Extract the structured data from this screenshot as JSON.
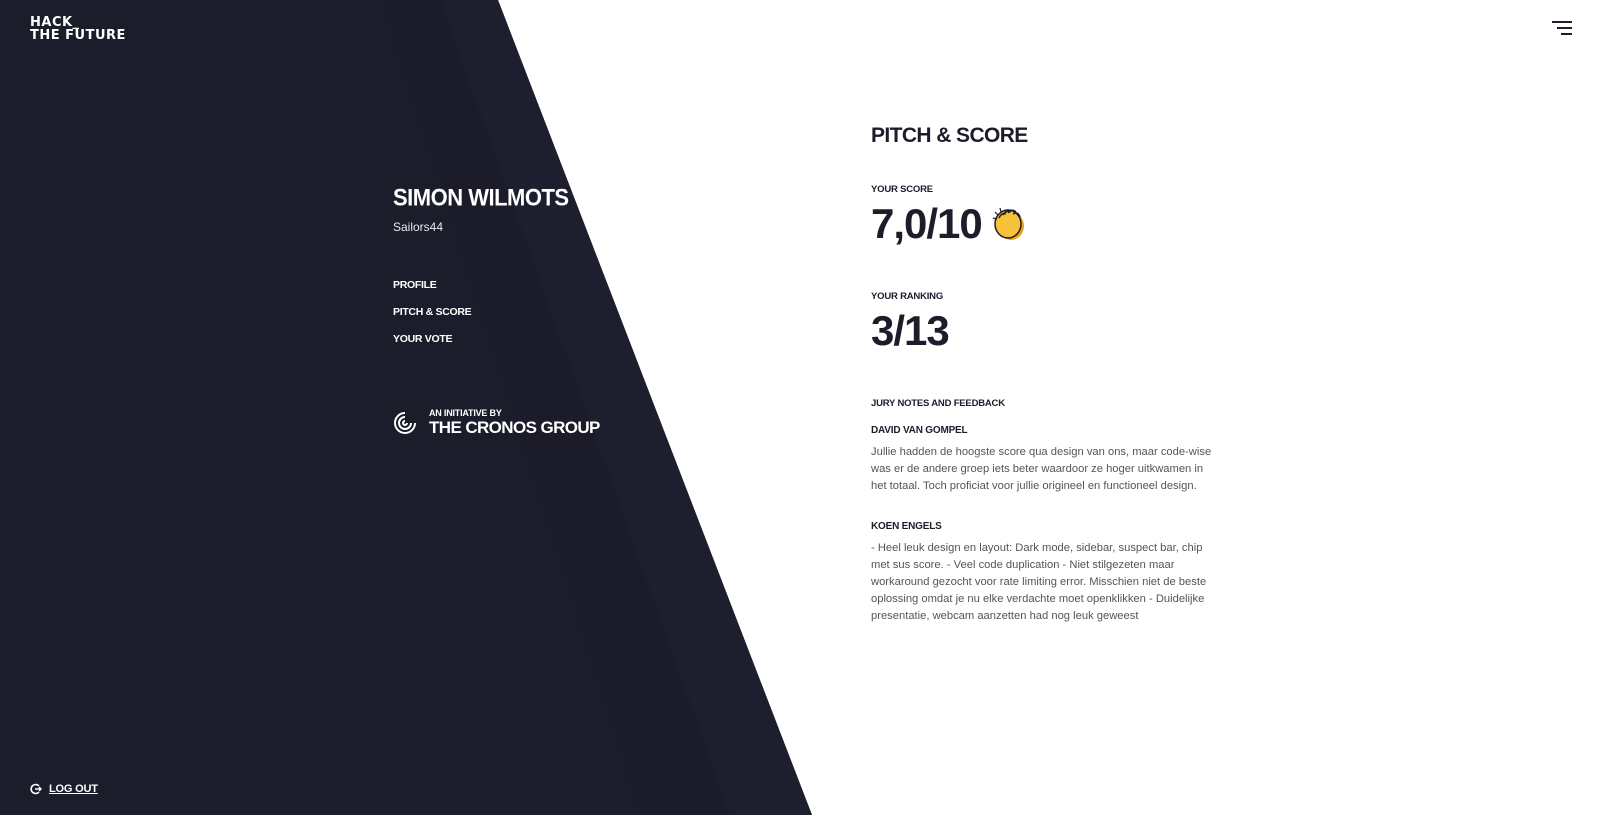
{
  "brand": {
    "logo_line1": "HACK_",
    "logo_line2": "THE FUTURE"
  },
  "header": {
    "menu_icon": "hamburger-menu-icon"
  },
  "sidebar": {
    "user_name": "SIMON WILMOTS",
    "team_name": "Sailors44",
    "nav": [
      {
        "label": "PROFILE"
      },
      {
        "label": "PITCH & SCORE"
      },
      {
        "label": "YOUR VOTE"
      }
    ],
    "initiative_small": "AN INITIATIVE BY",
    "initiative_big": "THE CRONOS GROUP",
    "initiative_icon": "cronos-swirl-icon",
    "logout_label": "LOG OUT",
    "logout_icon": "logout-icon"
  },
  "main": {
    "title": "PITCH & SCORE",
    "score_label": "YOUR SCORE",
    "score_value": "7,0/10",
    "score_emoji": "clapping-hands-icon",
    "ranking_label": "YOUR RANKING",
    "ranking_value": "3/13",
    "jury_heading": "JURY NOTES AND FEEDBACK",
    "jury": [
      {
        "name": "DAVID VAN GOMPEL",
        "text": "Jullie hadden de hoogste score qua design van ons, maar code-wise was er de andere groep iets beter waardoor ze hoger uitkwamen in het totaal. Toch proficiat voor jullie origineel en functioneel design."
      },
      {
        "name": "KOEN ENGELS",
        "text": "- Heel leuk design en layout: Dark mode, sidebar, suspect bar, chip met sus score. - Veel code duplication - Niet stilgezeten maar workaround gezocht voor rate limiting error. Misschien niet de beste oplossing omdat je nu elke verdachte moet openklikken - Duidelijke presentatie, webcam aanzetten had nog leuk geweest"
      }
    ]
  },
  "colors": {
    "dark": "#1c1d2b",
    "darker_shade": "#1a1b28",
    "background": "#ffffff",
    "emoji_yellow": "#f7b731"
  }
}
